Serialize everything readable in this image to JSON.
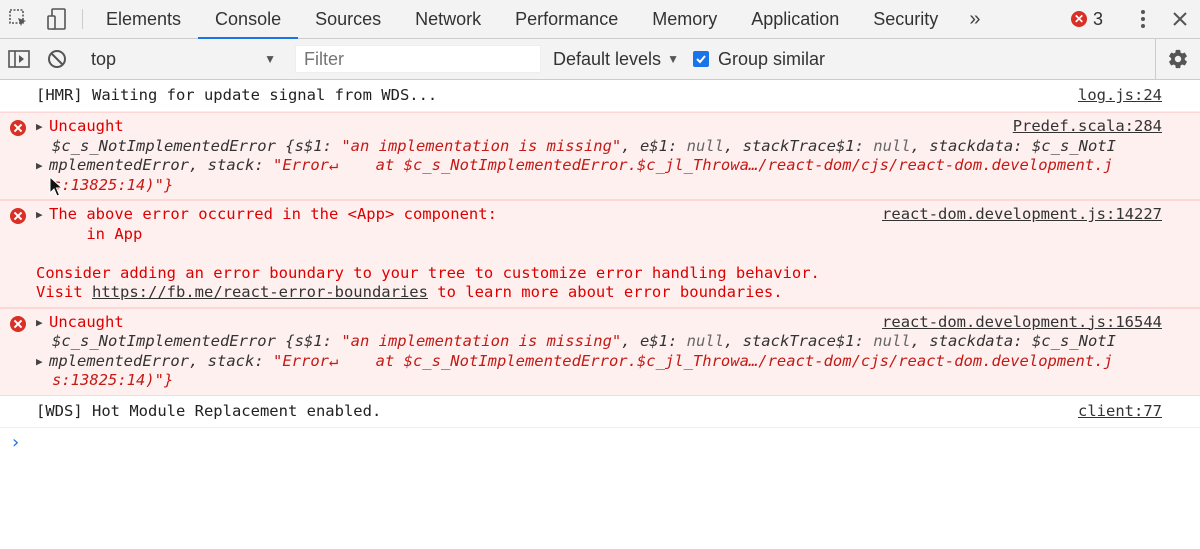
{
  "tabs": [
    "Elements",
    "Console",
    "Sources",
    "Network",
    "Performance",
    "Memory",
    "Application",
    "Security"
  ],
  "active_tab": "Console",
  "more_tabs": "»",
  "error_count": "3",
  "toolbar": {
    "context": "top",
    "filter_placeholder": "Filter",
    "levels": "Default levels",
    "group_similar": "Group similar",
    "group_similar_checked": true
  },
  "messages": {
    "m1": {
      "text": "[HMR] Waiting for update signal from WDS...",
      "source": "log.js:24"
    },
    "m2": {
      "title": "Uncaught",
      "source": "Predef.scala:284",
      "l2_name": "$c_s_NotImplementedError",
      "l2_open": " {",
      "l2_k1": "s$1",
      "l2_v1": "\"an implementation is missing\"",
      "l2_k2": "e$1",
      "l2_v2": "null",
      "l2_k3": "stackTrace$1",
      "l2_v3": "null",
      "l2_k4": "stackdata",
      "l2_v4": "$c_s_NotI",
      "l3_a": "mplementedError",
      "l3_k": "stack",
      "l3_v": "\"Error↵    at $c_s_NotImplementedError.$c_jl_Throwa…/react-dom/cjs/react-dom.development.j",
      "l4": "s:13825:14)\"}"
    },
    "m3": {
      "line1": "The above error occurred in the <App> component:",
      "line2": "    in App",
      "line4": "Consider adding an error boundary to your tree to customize error handling behavior.",
      "line5_a": "Visit ",
      "line5_link": "https://fb.me/react-error-boundaries",
      "line5_b": " to learn more about error boundaries.",
      "source": "react-dom.development.js:14227"
    },
    "m4": {
      "title": "Uncaught",
      "source": "react-dom.development.js:16544",
      "l2_name": "$c_s_NotImplementedError",
      "l2_open": " {",
      "l2_k1": "s$1",
      "l2_v1": "\"an implementation is missing\"",
      "l2_k2": "e$1",
      "l2_v2": "null",
      "l2_k3": "stackTrace$1",
      "l2_v3": "null",
      "l2_k4": "stackdata",
      "l2_v4": "$c_s_NotI",
      "l3_a": "mplementedError",
      "l3_k": "stack",
      "l3_v": "\"Error↵    at $c_s_NotImplementedError.$c_jl_Throwa…/react-dom/cjs/react-dom.development.j",
      "l4": "s:13825:14)\"}"
    },
    "m5": {
      "text": "[WDS] Hot Module Replacement enabled.",
      "source": "client:77"
    }
  },
  "prompt": "›",
  "colors": {
    "accent": "#1a73e8",
    "error": "#d93025",
    "error_bg": "#fff0f0"
  }
}
